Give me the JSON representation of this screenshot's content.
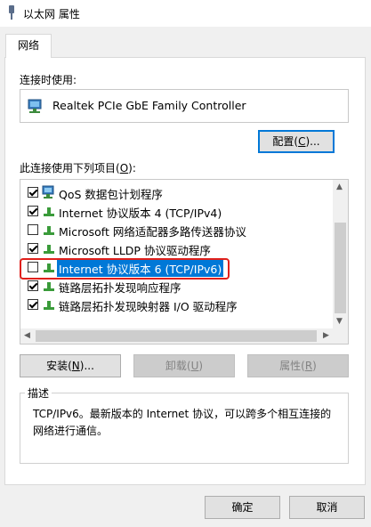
{
  "window": {
    "title": "以太网 属性"
  },
  "tabs": [
    {
      "label": "网络"
    }
  ],
  "connect_using": {
    "label": "连接时使用:",
    "adapter": "Realtek PCIe GbE Family Controller",
    "configure_button": {
      "label": "配置",
      "mnemonic": "C"
    }
  },
  "items_section": {
    "label": "此连接使用下列项目",
    "mnemonic": "O",
    "items": [
      {
        "label": "QoS 数据包计划程序",
        "checked": true,
        "icon": "qos-network-icon"
      },
      {
        "label": "Internet 协议版本 4 (TCP/IPv4)",
        "checked": true,
        "icon": "protocol-icon"
      },
      {
        "label": "Microsoft 网络适配器多路传送器协议",
        "checked": false,
        "icon": "protocol-icon"
      },
      {
        "label": "Microsoft LLDP 协议驱动程序",
        "checked": true,
        "icon": "protocol-icon"
      },
      {
        "label": "Internet 协议版本 6 (TCP/IPv6)",
        "checked": false,
        "icon": "protocol-icon",
        "selected": true
      },
      {
        "label": "链路层拓扑发现响应程序",
        "checked": true,
        "icon": "protocol-icon"
      },
      {
        "label": "链路层拓扑发现映射器 I/O 驱动程序",
        "checked": true,
        "icon": "protocol-icon"
      }
    ]
  },
  "buttons": {
    "install": {
      "label": "安装",
      "mnemonic": "N"
    },
    "uninstall": {
      "label": "卸载",
      "mnemonic": "U"
    },
    "properties": {
      "label": "属性",
      "mnemonic": "R"
    }
  },
  "description": {
    "legend": "描述",
    "text": "TCP/IPv6。最新版本的 Internet 协议，可以跨多个相互连接的网络进行通信。"
  },
  "footer": {
    "ok": "确定",
    "cancel": "取消"
  },
  "colors": {
    "selection": "#0078d7",
    "highlight_border": "#e0201b",
    "focus_border": "#0078d7"
  }
}
